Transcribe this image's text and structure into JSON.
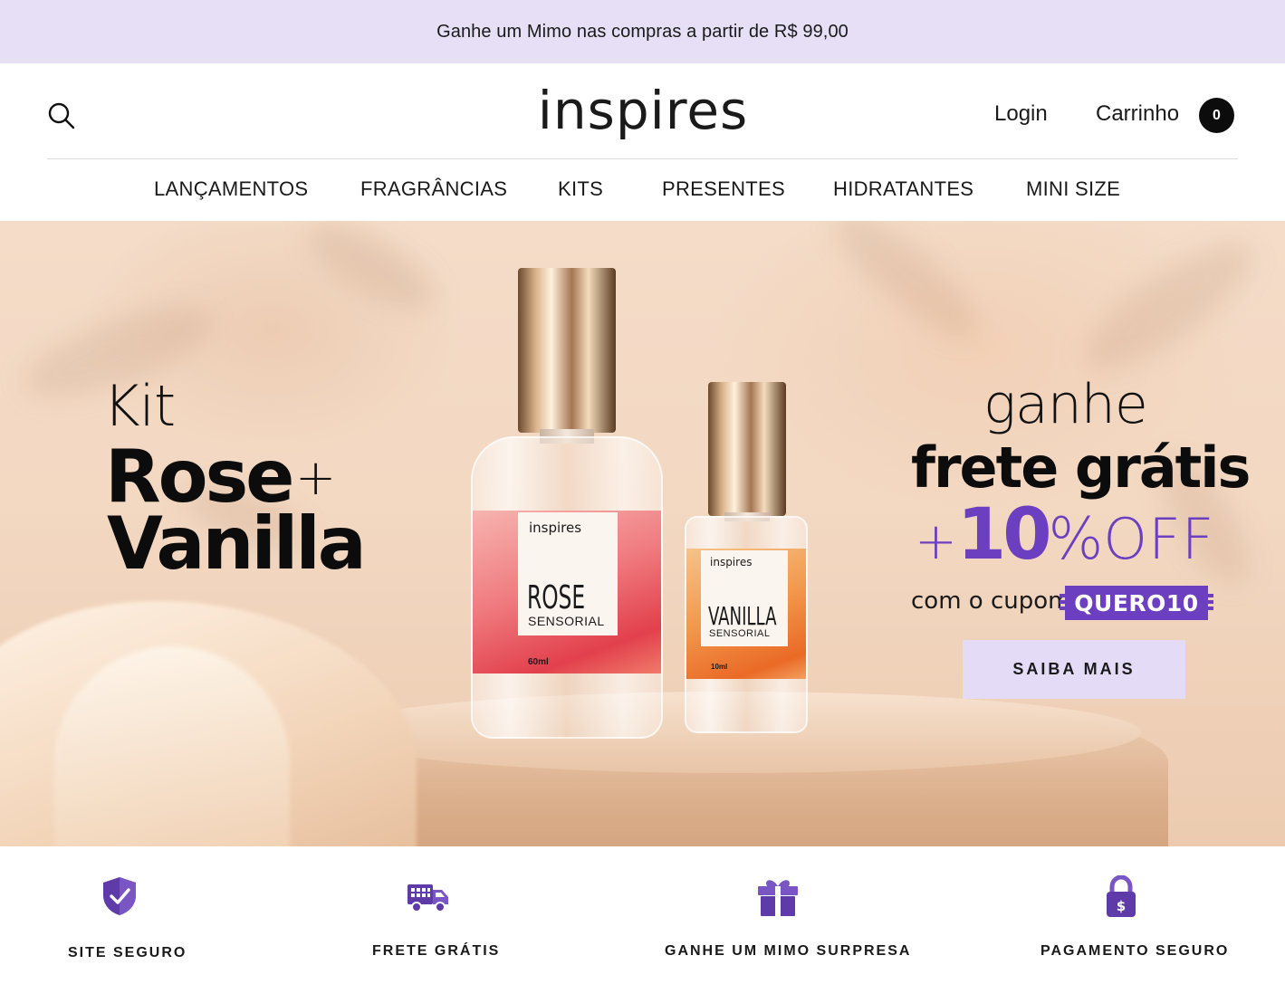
{
  "promo": {
    "text": "Ganhe um Mimo nas compras a partir de R$ 99,00"
  },
  "header": {
    "logo": "inspires",
    "login_label": "Login",
    "cart_label": "Carrinho",
    "cart_count": "0"
  },
  "nav": {
    "items": [
      {
        "label": "LANÇAMENTOS"
      },
      {
        "label": "FRAGRÂNCIAS"
      },
      {
        "label": "KITS"
      },
      {
        "label": "PRESENTES"
      },
      {
        "label": "HIDRATANTES"
      },
      {
        "label": "MINI SIZE"
      }
    ]
  },
  "hero": {
    "kit": "Kit",
    "rose": "Rose",
    "plus": "+",
    "vanilla": "Vanilla",
    "ganhe": "ganhe",
    "frete": "frete grátis",
    "off_plus": "+",
    "off_number": "10",
    "off_percent": "%",
    "off_text": "OFF",
    "cupom_text": "com o cupom",
    "cupom_code": "QUERO10",
    "cta_label": "SAIBA MAIS",
    "bottle_rose": {
      "brand": "inspires",
      "name": "ROSE",
      "sub": "SENSORIAL",
      "volume": "60ml"
    },
    "bottle_vanilla": {
      "brand": "inspires",
      "name": "VANILLA",
      "sub": "SENSORIAL",
      "volume": "10ml"
    }
  },
  "features": [
    {
      "label": "SITE SEGURO",
      "icon": "shield-check-icon"
    },
    {
      "label": "FRETE GRÁTIS",
      "icon": "truck-icon"
    },
    {
      "label": "GANHE UM MIMO SURPRESA",
      "icon": "gift-icon"
    },
    {
      "label": "PAGAMENTO SEGURO",
      "icon": "padlock-dollar-icon"
    }
  ],
  "colors": {
    "promo_bg": "#e6dff5",
    "accent_purple": "#6b3fbf",
    "cta_bg": "#e4dbf6",
    "icon_purple": "#5e3ba8"
  }
}
